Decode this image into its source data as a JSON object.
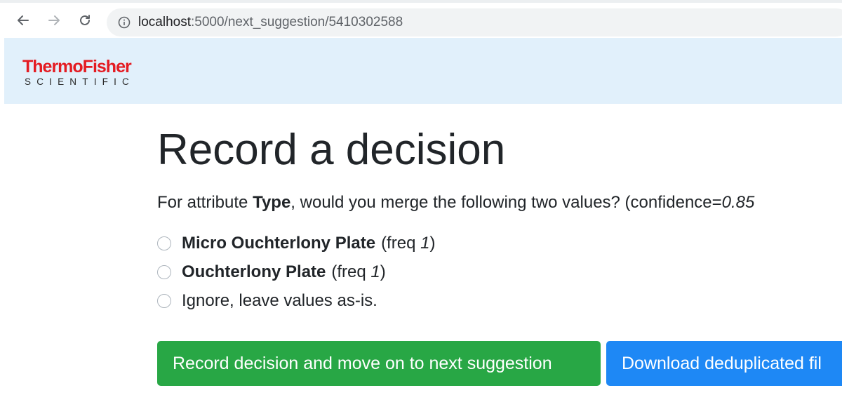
{
  "browser": {
    "url_host": "localhost",
    "url_rest": ":5000/next_suggestion/5410302588",
    "icons": [
      "back-arrow-icon",
      "forward-arrow-icon",
      "reload-icon",
      "info-icon"
    ]
  },
  "brand": {
    "logo_main": "ThermoFisher",
    "logo_sub": "SCIENTIFIC",
    "accent": "#e41b22",
    "band_color": "#e1f0fb"
  },
  "page": {
    "title": "Record a decision",
    "question_prefix": "For attribute ",
    "attribute": "Type",
    "question_middle": ", would you merge the following two values? (confidence=",
    "confidence": "0.85"
  },
  "options": [
    {
      "name": "Micro Ouchterlony Plate",
      "freq_label": "(freq ",
      "freq_value": "1",
      "freq_close": ")"
    },
    {
      "name": "Ouchterlony Plate",
      "freq_label": "(freq ",
      "freq_value": "1",
      "freq_close": ")"
    },
    {
      "name": "",
      "text": "Ignore, leave values as-is."
    }
  ],
  "actions": {
    "record_label": "Record decision and move on to next suggestion",
    "download_label": "Download deduplicated fil",
    "record_color": "#28a745",
    "download_color": "#1e88f5"
  }
}
